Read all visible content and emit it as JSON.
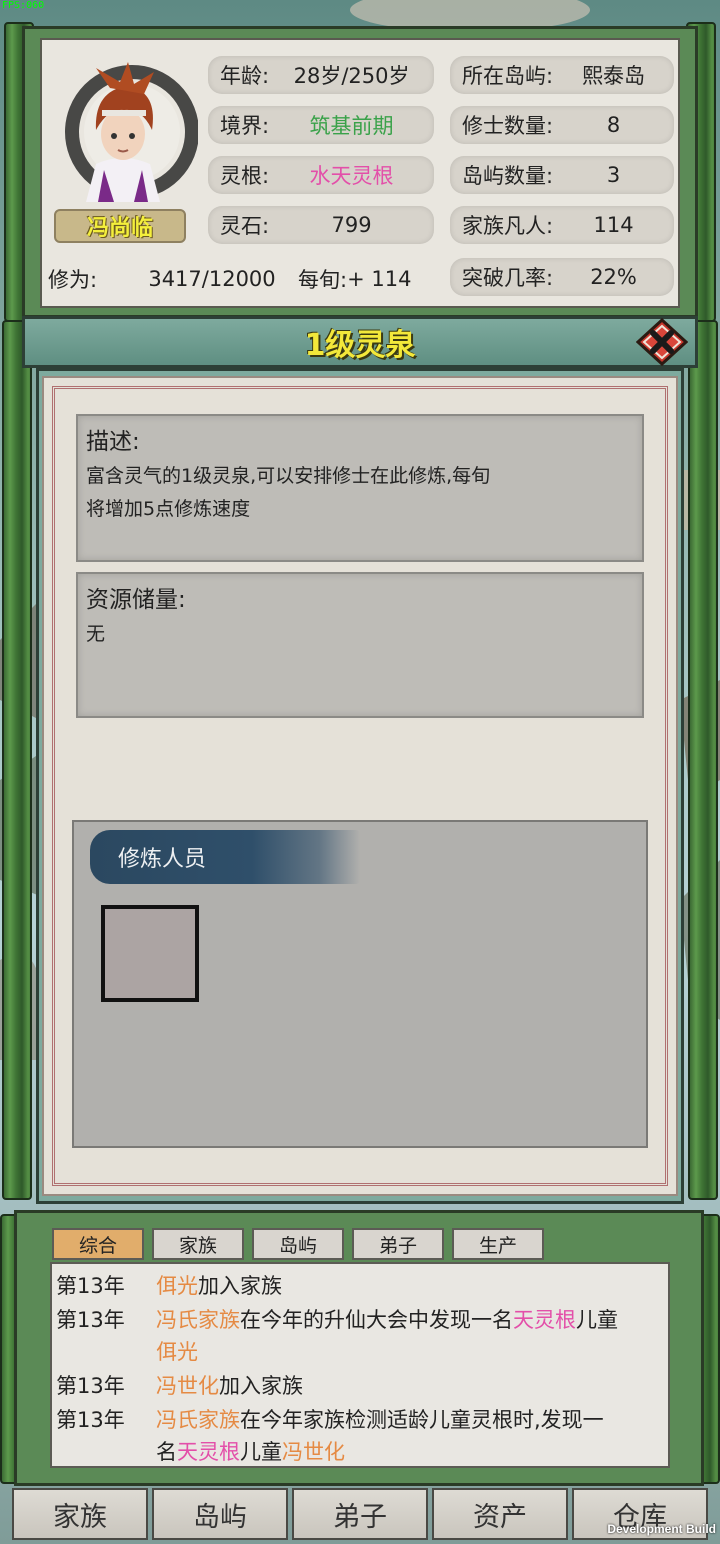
{
  "debug": {
    "fps": "FPS:060",
    "build": "Development Build"
  },
  "character": {
    "name": "冯尚临",
    "age_label": "年龄:",
    "age_value": "28岁/250岁",
    "realm_label": "境界:",
    "realm_value": "筑基前期",
    "root_label": "灵根:",
    "root_value": "水天灵根",
    "stone_label": "灵石:",
    "stone_value": "799",
    "cultivation_label": "修为:",
    "cultivation_value": "3417/12000",
    "per_turn_label": "每旬:",
    "per_turn_value": "+ 114"
  },
  "stats": {
    "island_label": "所在岛屿:",
    "island_value": "熙泰岛",
    "cultivators_label": "修士数量:",
    "cultivators_value": "8",
    "islands_label": "岛屿数量:",
    "islands_value": "3",
    "mortals_label": "家族凡人:",
    "mortals_value": "114",
    "breakthrough_label": "突破几率:",
    "breakthrough_value": "22%"
  },
  "dialog": {
    "title": "1级灵泉",
    "desc_header": "描述:",
    "desc_line1": "富含灵气的1级灵泉,可以安排修士在此修炼,每旬",
    "desc_line2": "将增加5点修炼速度",
    "res_header": "资源储量:",
    "res_value": "无",
    "staff_label": "修炼人员"
  },
  "log": {
    "tabs": [
      "综合",
      "家族",
      "岛屿",
      "弟子",
      "生产"
    ],
    "l1_year": "第13年",
    "l1_a": "佴光",
    "l1_b": "加入家族",
    "l2_year": "第13年",
    "l2_a": "冯氏家族",
    "l2_b": "在今年的升仙大会中发现一名",
    "l2_c": "天灵根",
    "l2_d": "儿童",
    "l2_e": "佴光",
    "l3_year": "第13年",
    "l3_a": "冯世化",
    "l3_b": "加入家族",
    "l4_year": "第13年",
    "l4_a": "冯氏家族",
    "l4_b": "在今年家族检测适龄儿童灵根时,发现一",
    "l4_c": "名",
    "l4_d": "天灵根",
    "l4_e": "儿童",
    "l4_f": "冯世化"
  },
  "nav": [
    "家族",
    "岛屿",
    "弟子",
    "资产",
    "仓库"
  ],
  "colors": {
    "realm": "#3aa24a",
    "root": "#e34fa9",
    "orange_name": "#e58a43",
    "title": "#f3e83a"
  }
}
